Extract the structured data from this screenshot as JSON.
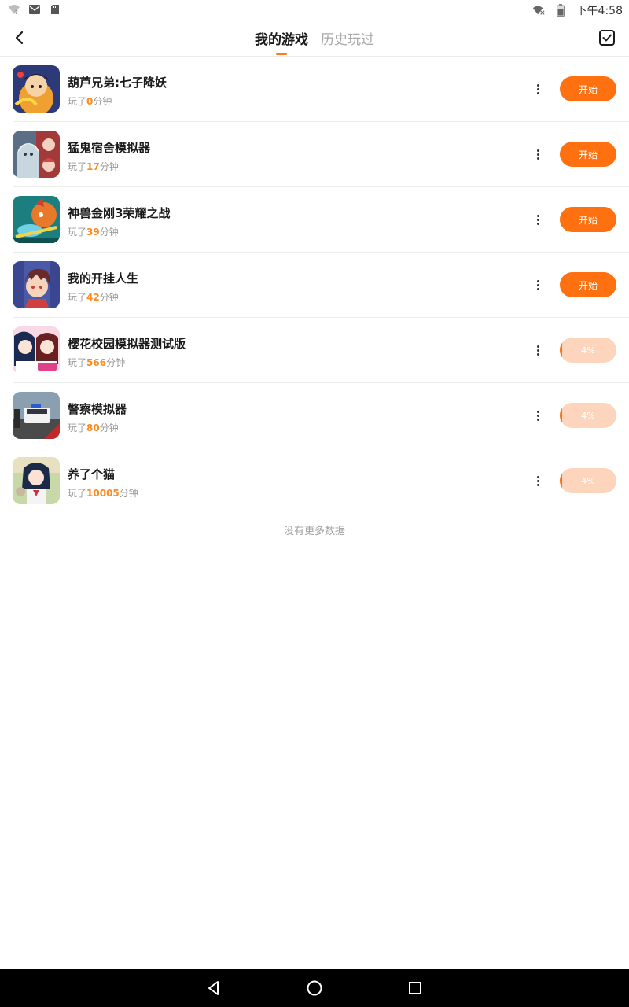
{
  "status_bar": {
    "time": "下午4:58",
    "icons": [
      "wifi-question-icon",
      "mail-icon",
      "sd-card-icon",
      "wifi-x-icon",
      "battery-icon"
    ]
  },
  "header": {
    "tabs": [
      {
        "label": "我的游戏",
        "active": true
      },
      {
        "label": "历史玩过",
        "active": false
      }
    ],
    "back_icon": "chevron-left-icon",
    "manage_icon": "checkbox-icon"
  },
  "colors": {
    "accent": "#ff7010",
    "accent_light": "#fdd5bd",
    "highlight_number": "#ff8a1f"
  },
  "games": [
    {
      "name": "葫芦兄弟:七子降妖",
      "played_prefix": "玩了",
      "minutes": "0",
      "played_suffix": "分钟",
      "action": "开始",
      "progress": null
    },
    {
      "name": "猛鬼宿舍模拟器",
      "played_prefix": "玩了",
      "minutes": "17",
      "played_suffix": "分钟",
      "action": "开始",
      "progress": null
    },
    {
      "name": "神兽金刚3荣耀之战",
      "played_prefix": "玩了",
      "minutes": "39",
      "played_suffix": "分钟",
      "action": "开始",
      "progress": null
    },
    {
      "name": "我的开挂人生",
      "played_prefix": "玩了",
      "minutes": "42",
      "played_suffix": "分钟",
      "action": "开始",
      "progress": null
    },
    {
      "name": "樱花校园模拟器测试版",
      "played_prefix": "玩了",
      "minutes": "566",
      "played_suffix": "分钟",
      "action": "4%",
      "progress": 0.04
    },
    {
      "name": "警察模拟器",
      "played_prefix": "玩了",
      "minutes": "80",
      "played_suffix": "分钟",
      "action": "4%",
      "progress": 0.04
    },
    {
      "name": "养了个猫",
      "played_prefix": "玩了",
      "minutes": "10005",
      "played_suffix": "分钟",
      "action": "4%",
      "progress": 0.04
    }
  ],
  "footer_text": "没有更多数据",
  "nav_bar": {
    "icons": [
      "back-triangle-icon",
      "home-circle-icon",
      "recents-square-icon"
    ]
  }
}
